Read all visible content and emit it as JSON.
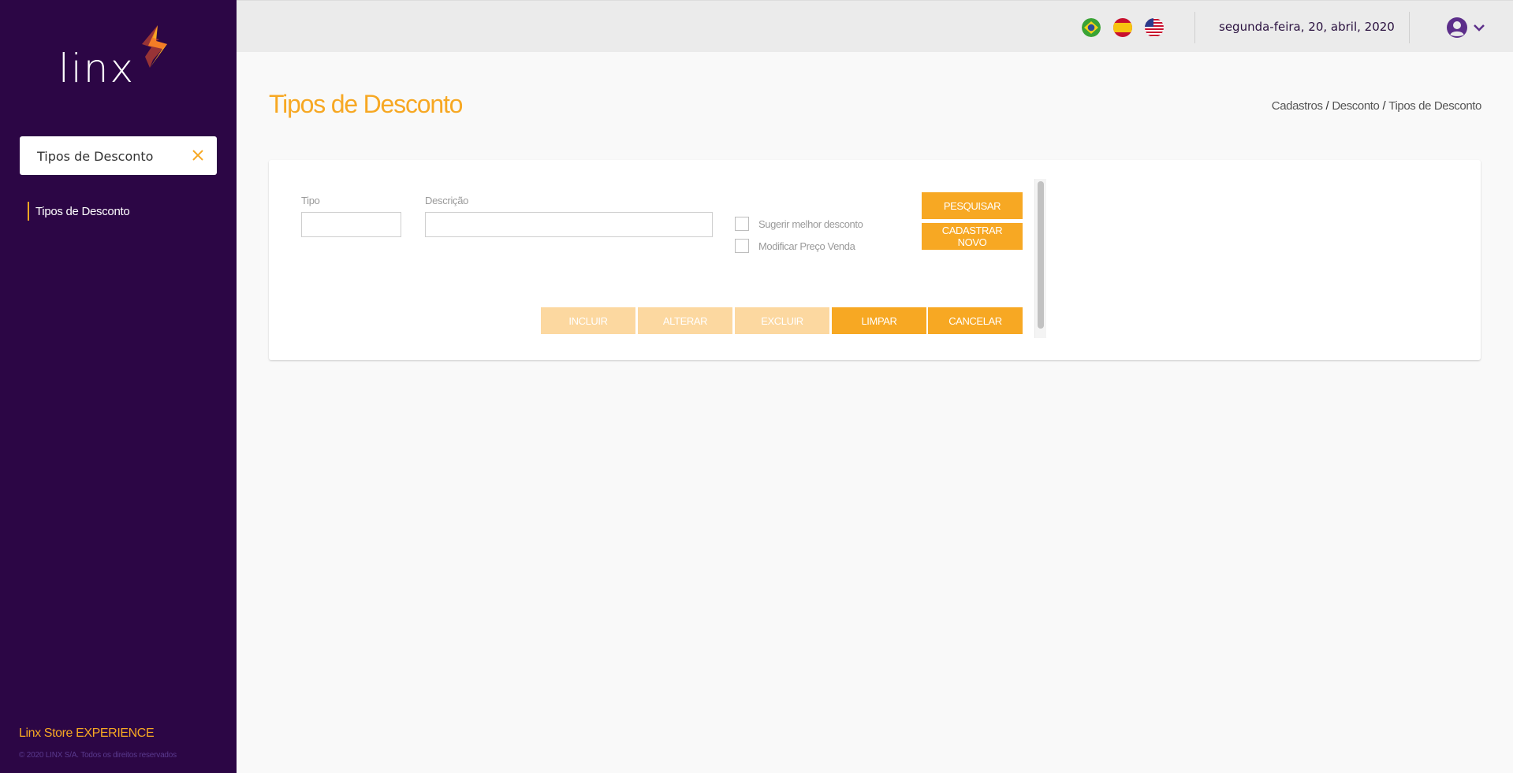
{
  "sidebar": {
    "logo_text": "linx",
    "search": {
      "value": "Tipos de Desconto",
      "placeholder": ""
    },
    "menu_items": [
      {
        "label": "Tipos de Desconto"
      }
    ],
    "footer_brand": "Linx Store EXPERIENCE",
    "footer_copyright": "© 2020 LINX S/A. Todos os direitos reservados"
  },
  "header": {
    "flags": [
      "brazil-flag-icon",
      "spain-flag-icon",
      "usa-flag-icon"
    ],
    "date": "segunda-feira, 20, abril, 2020",
    "user_icon": "user-circle-icon"
  },
  "page": {
    "title": "Tipos de Desconto",
    "breadcrumb": [
      "Cadastros",
      "Desconto",
      "Tipos de Desconto"
    ],
    "breadcrumb_separator": "/"
  },
  "form": {
    "tipo_label": "Tipo",
    "tipo_value": "",
    "descricao_label": "Descrição",
    "descricao_value": "",
    "checkboxes": [
      {
        "label": "Sugerir melhor desconto",
        "checked": false
      },
      {
        "label": "Modificar Preço Venda",
        "checked": false
      }
    ],
    "pesquisar_label": "PESQUISAR",
    "cadastrar_label": "CADASTRAR NOVO",
    "actions": [
      {
        "label": "INCLUIR",
        "enabled": false
      },
      {
        "label": "ALTERAR",
        "enabled": false
      },
      {
        "label": "EXCLUIR",
        "enabled": false
      },
      {
        "label": "LIMPAR",
        "enabled": true
      },
      {
        "label": "CANCELAR",
        "enabled": true
      }
    ]
  },
  "colors": {
    "sidebar_bg": "#2c0645",
    "accent": "#f7a823",
    "accent_disabled": "#fcd8a0",
    "topbar_bg": "#ebebeb",
    "content_bg": "#f9f9f9"
  }
}
